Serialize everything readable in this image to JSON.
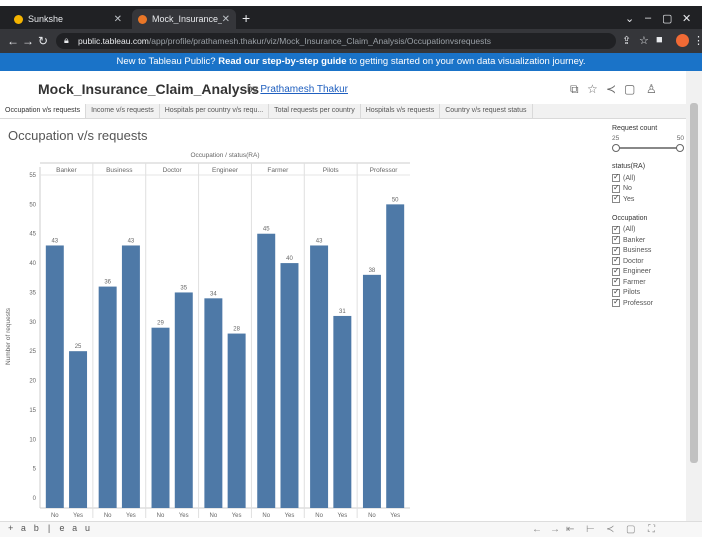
{
  "browser": {
    "tabs": [
      {
        "label": "Sunkshe",
        "active": false
      },
      {
        "label": "Mock_Insurance_Claim_Analysis",
        "active": true
      }
    ],
    "url_host": "public.tableau.com",
    "url_path": "/app/profile/prathamesh.thakur/viz/Mock_Insurance_Claim_Analysis/Occupationvsrequests"
  },
  "banner": {
    "lead": "New to Tableau Public?",
    "link": "Read our step-by-step guide",
    "tail": "to getting started on your own data visualization journey."
  },
  "workbook": {
    "title": "Mock_Insurance_Claim_Analysis",
    "by": "by",
    "author": "Prathamesh Thakur"
  },
  "sheet_tabs": [
    "Occupation v/s requests",
    "Income v/s requests",
    "Hospitals per country v/s requ...",
    "Total requests per country",
    "Hospitals v/s requests",
    "Country v/s request status"
  ],
  "sheet": {
    "title": "Occupation v/s requests"
  },
  "chart_data": {
    "type": "bar",
    "header": "Occupation / status(RA)",
    "ylabel": "Number of requests",
    "ylim": [
      0,
      55
    ],
    "yticks": [
      0,
      5,
      10,
      15,
      20,
      25,
      30,
      35,
      40,
      45,
      50,
      55
    ],
    "groups": [
      {
        "name": "Banker",
        "bars": [
          {
            "cat": "No",
            "value": 43
          },
          {
            "cat": "Yes",
            "value": 25
          }
        ]
      },
      {
        "name": "Business",
        "bars": [
          {
            "cat": "No",
            "value": 36
          },
          {
            "cat": "Yes",
            "value": 43
          }
        ]
      },
      {
        "name": "Doctor",
        "bars": [
          {
            "cat": "No",
            "value": 29
          },
          {
            "cat": "Yes",
            "value": 35
          }
        ]
      },
      {
        "name": "Engineer",
        "bars": [
          {
            "cat": "No",
            "value": 34
          },
          {
            "cat": "Yes",
            "value": 28
          }
        ]
      },
      {
        "name": "Farmer",
        "bars": [
          {
            "cat": "No",
            "value": 45
          },
          {
            "cat": "Yes",
            "value": 40
          }
        ]
      },
      {
        "name": "Pilots",
        "bars": [
          {
            "cat": "No",
            "value": 43
          },
          {
            "cat": "Yes",
            "value": 31
          }
        ]
      },
      {
        "name": "Professor",
        "bars": [
          {
            "cat": "No",
            "value": 38
          },
          {
            "cat": "Yes",
            "value": 50
          }
        ]
      }
    ],
    "bar_color": "#4e79a7",
    "grid": false
  },
  "filters": {
    "request_count": {
      "label": "Request count",
      "min": "25",
      "max": "50"
    },
    "status": {
      "label": "status(RA)",
      "options": [
        "(All)",
        "No",
        "Yes"
      ]
    },
    "occupation": {
      "label": "Occupation",
      "options": [
        "(All)",
        "Banker",
        "Business",
        "Doctor",
        "Engineer",
        "Farmer",
        "Pilots",
        "Professor"
      ]
    }
  },
  "footer": {
    "logo": "+ a b | e a u"
  }
}
